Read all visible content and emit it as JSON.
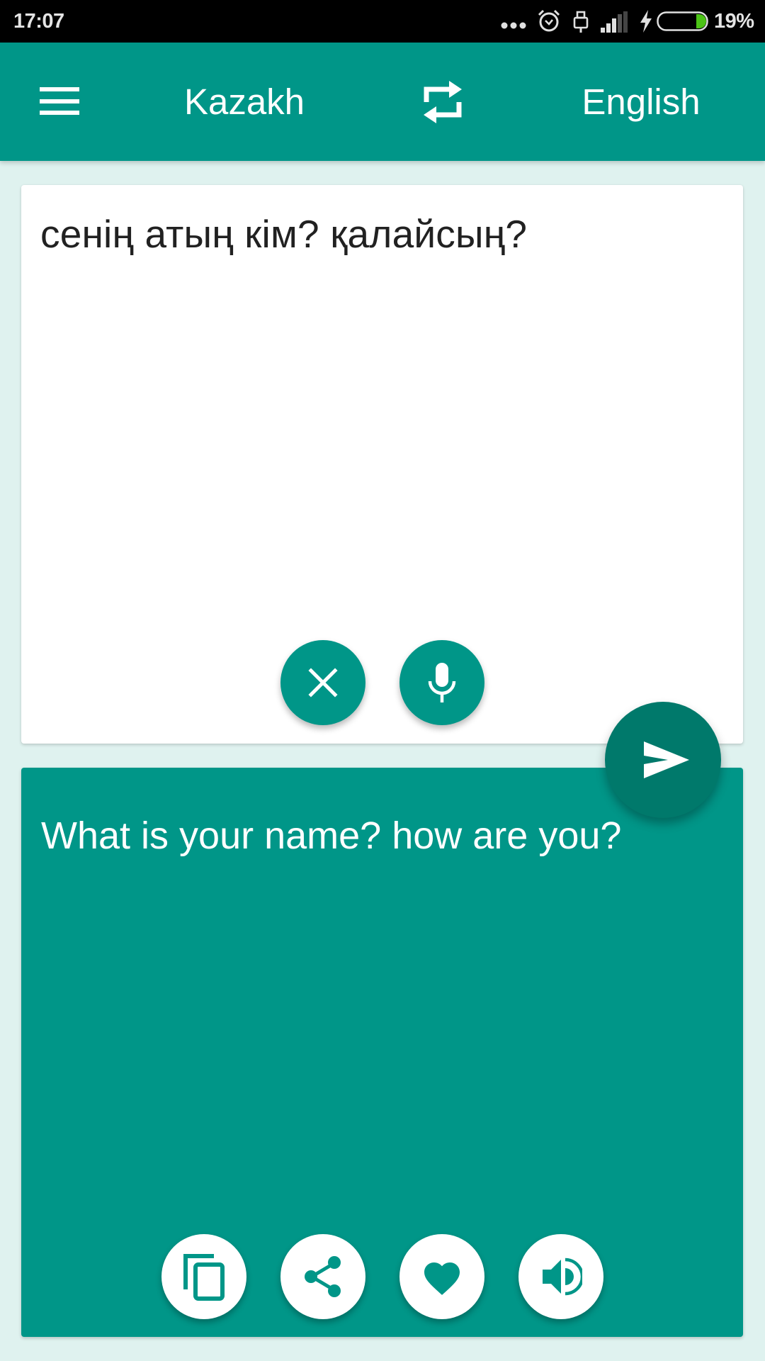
{
  "status_bar": {
    "time": "17:07",
    "battery_percent": "19%",
    "battery_level": 0.19,
    "icons": [
      "more-notifications-icon",
      "alarm-icon",
      "usb-icon",
      "signal-icon",
      "charging-bolt-icon",
      "battery-icon"
    ]
  },
  "app_bar": {
    "menu_icon": "hamburger-menu-icon",
    "source_language": "Kazakh",
    "swap_icon": "swap-languages-icon",
    "target_language": "English"
  },
  "input": {
    "text": "сенің атың кім? қалайсың?",
    "clear_icon": "close-icon",
    "mic_icon": "microphone-icon"
  },
  "send": {
    "icon": "send-icon"
  },
  "output": {
    "text": "What is your name? how are you?",
    "actions": [
      {
        "name": "copy",
        "icon": "copy-icon"
      },
      {
        "name": "share",
        "icon": "share-icon"
      },
      {
        "name": "favorite",
        "icon": "heart-icon"
      },
      {
        "name": "speak",
        "icon": "speaker-icon"
      }
    ]
  },
  "colors": {
    "primary": "#009688",
    "primary_dark": "#00796B",
    "background": "#DFF2EF",
    "status_bar": "#000000",
    "battery_fill": "#4CC417"
  }
}
